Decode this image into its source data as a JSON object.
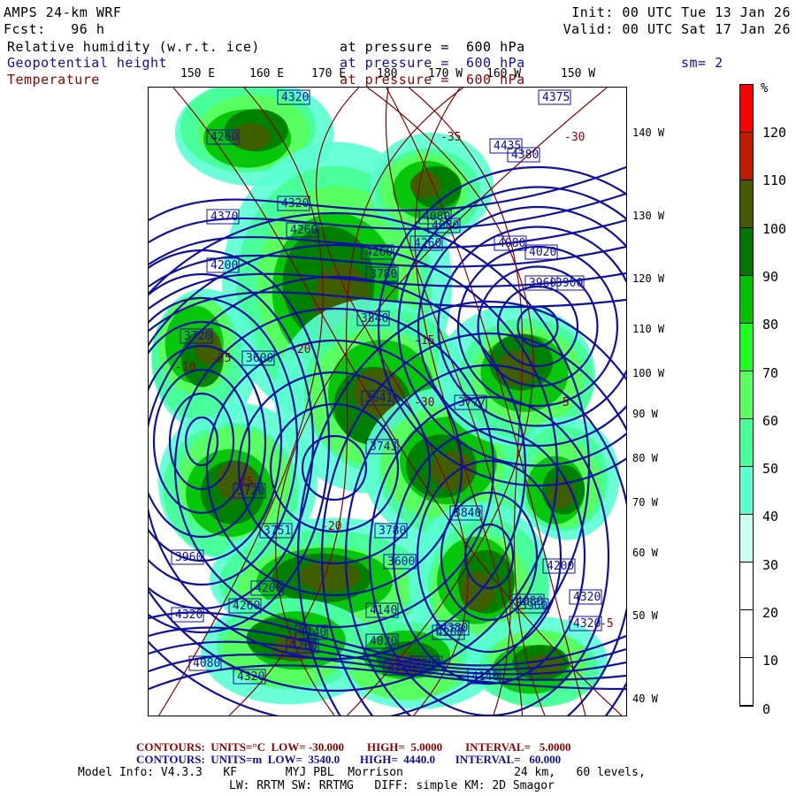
{
  "header": {
    "model": "AMPS 24-km WRF",
    "forecast": "Fcst:   96 h",
    "init": "Init: 00 UTC Tue 13 Jan 26",
    "valid": "Valid: 00 UTC Sat 17 Jan 26",
    "fields": [
      {
        "name": "Relative humidity (w.r.t. ice)",
        "level": "at pressure =  600 hPa",
        "color": "#000000"
      },
      {
        "name": "Geopotential height",
        "level": "at pressure =  600 hPa",
        "color": "#1010a0"
      },
      {
        "name": "Temperature",
        "level": "at pressure =  600 hPa",
        "color": "#900000"
      }
    ],
    "smoothing": "sm= 2"
  },
  "map": {
    "lon_labels": [
      "150 E",
      "160 E",
      "170 E",
      "180",
      "170 W",
      "160 W",
      "150 W"
    ],
    "lat_labels": [
      "140 W",
      "130 W",
      "120 W",
      "110 W",
      "100 W",
      "90 W",
      "80 W",
      "70 W",
      "60 W",
      "50 W",
      "40 W"
    ],
    "height_labels": [
      "4320",
      "4375",
      "4435",
      "4380",
      "4260",
      "4370",
      "4320",
      "4260",
      "4200",
      "4080",
      "4260",
      "4260",
      "4080",
      "4080",
      "4020",
      "3960",
      "3900",
      "3780",
      "3840",
      "3720",
      "3600",
      "3641",
      "3743",
      "3777",
      "3840",
      "3780",
      "3720",
      "3751",
      "3600",
      "3960",
      "4080",
      "4140",
      "4200",
      "4260",
      "4320",
      "4320",
      "4380",
      "4260",
      "4140",
      "4020",
      "3960",
      "4080",
      "4200",
      "4320",
      "4080",
      "4200",
      "4140",
      "4380",
      "4320"
    ],
    "temp_labels": [
      "-35",
      "-30",
      "-25",
      "-20",
      "-15",
      "-10",
      "-5",
      "-30",
      "-25",
      "-20",
      "-5"
    ],
    "colors": {
      "height": "#1010a0",
      "temperature": "#8b0000",
      "land": "#000000"
    }
  },
  "colorbar": {
    "unit": "%",
    "labels": [
      "120",
      "110",
      "100",
      "90",
      "80",
      "70",
      "60",
      "50",
      "40",
      "30",
      "20",
      "10",
      "0"
    ],
    "colors": [
      "#ff0000",
      "#c01a00",
      "#465a00",
      "#007800",
      "#00c000",
      "#1eff1e",
      "#5aff5a",
      "#46ff96",
      "#5affd2",
      "#c8fff0",
      "#ffffff",
      "#ffffff",
      "#ffffff"
    ]
  },
  "footer": {
    "temp_contours": "CONTOURS:  UNITS=°C  LOW= -30.000        HIGH=  5.0000        INTERVAL=   5.0000",
    "height_contours": "CONTOURS:  UNITS=m  LOW=  3540.0       HIGH=  4440.0       INTERVAL=   60.000",
    "model_info": "Model Info: V4.3.3   KF       MYJ PBL  Morrison                24 km,   60 levels,",
    "physics": "LW: RRTM SW: RRTMG   DIFF: simple KM: 2D Smagor"
  }
}
